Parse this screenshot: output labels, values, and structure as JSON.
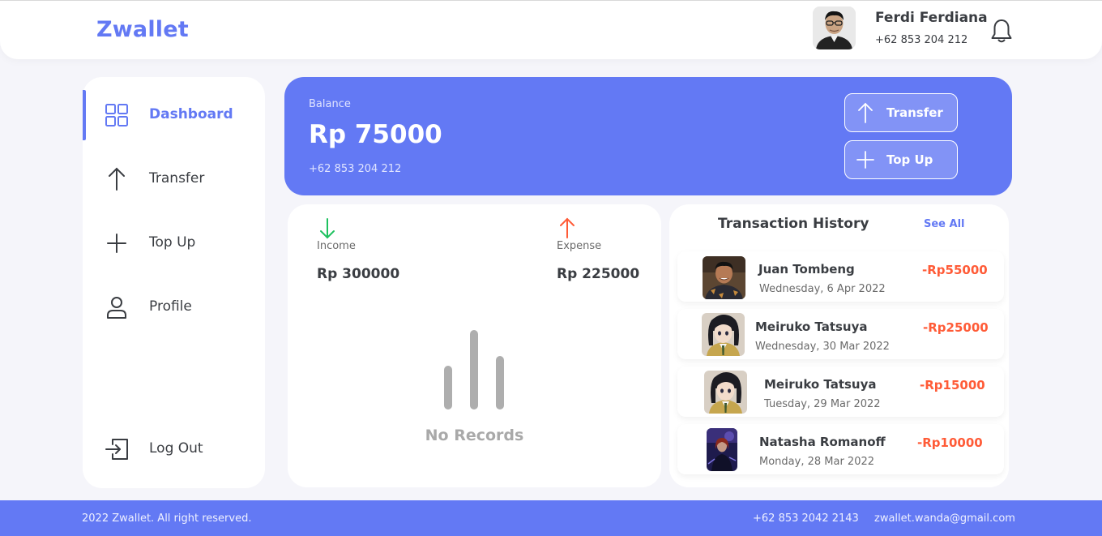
{
  "app": {
    "brand": "Zwallet"
  },
  "header": {
    "user_name": "Ferdi Ferdiana",
    "user_phone": "+62 853 204 212",
    "icons": {
      "avatar": "user-photo",
      "notification": "bell-icon"
    }
  },
  "sidebar": {
    "items": [
      {
        "label": "Dashboard",
        "icon": "grid-icon",
        "active": true
      },
      {
        "label": "Transfer",
        "icon": "arrow-up-icon",
        "active": false
      },
      {
        "label": "Top Up",
        "icon": "plus-icon",
        "active": false
      },
      {
        "label": "Profile",
        "icon": "user-icon",
        "active": false
      }
    ],
    "logout": {
      "label": "Log Out",
      "icon": "logout-icon"
    }
  },
  "balance": {
    "label": "Balance",
    "amount": "Rp 75000",
    "phone": "+62 853 204 212",
    "transfer_label": "Transfer",
    "topup_label": "Top Up"
  },
  "stats": {
    "income_label": "Income",
    "income_value": "Rp 300000",
    "expense_label": "Expense",
    "expense_value": "Rp 225000",
    "empty_text": "No Records"
  },
  "history": {
    "title": "Transaction History",
    "see_all": "See All",
    "items": [
      {
        "name": "Juan Tombeng",
        "date": "Wednesday, 6 Apr 2022",
        "amount": "-Rp55000"
      },
      {
        "name": "Meiruko Tatsuya",
        "date": "Wednesday, 30 Mar 2022",
        "amount": "-Rp25000"
      },
      {
        "name": "Meiruko Tatsuya",
        "date": "Tuesday, 29 Mar 2022",
        "amount": "-Rp15000"
      },
      {
        "name": "Natasha Romanoff",
        "date": "Monday, 28 Mar 2022",
        "amount": "-Rp10000"
      }
    ]
  },
  "footer": {
    "copyright": "2022 Zwallet. All right reserved.",
    "phone": "+62 853 2042 2143",
    "email": "zwallet.wanda@gmail.com"
  },
  "colors": {
    "primary": "#6379F4",
    "expense": "#FF5B37",
    "income": "#1EC15F",
    "background": "#F5F5FA"
  }
}
